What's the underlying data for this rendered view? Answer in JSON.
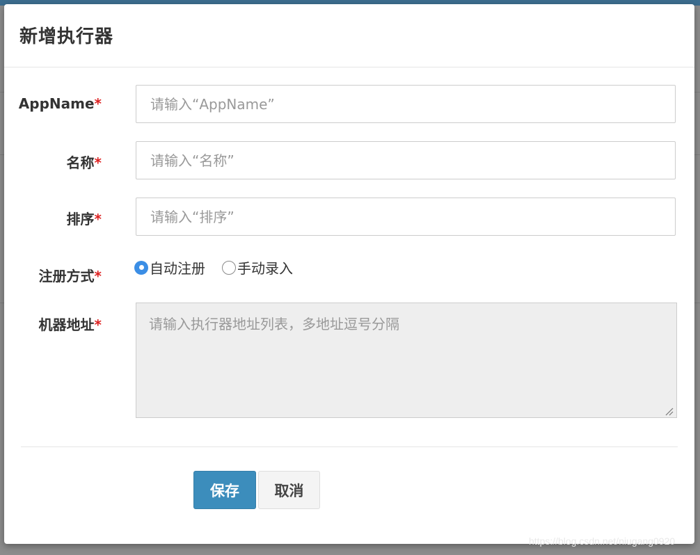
{
  "modal": {
    "title": "新增执行器"
  },
  "form": {
    "appname": {
      "label": "AppName",
      "required": "*",
      "placeholder": "请输入“AppName”",
      "value": ""
    },
    "title": {
      "label": "名称",
      "required": "*",
      "placeholder": "请输入“名称”",
      "value": ""
    },
    "order": {
      "label": "排序",
      "required": "*",
      "placeholder": "请输入“排序”",
      "value": ""
    },
    "address_type": {
      "label": "注册方式",
      "required": "*",
      "options": [
        {
          "label": "自动注册",
          "checked": true
        },
        {
          "label": "手动录入",
          "checked": false
        }
      ]
    },
    "address_list": {
      "label": "机器地址",
      "required": "*",
      "placeholder": "请输入执行器地址列表，多地址逗号分隔",
      "value": "",
      "disabled": true
    }
  },
  "buttons": {
    "save": "保存",
    "cancel": "取消"
  },
  "colors": {
    "primary": "#3c8dbc",
    "required_star": "#dd2222",
    "radio_checked": "#3b8ee5",
    "disabled_bg": "#eeeeee"
  },
  "watermark": "https://blog.csdn.net/niugang0920"
}
